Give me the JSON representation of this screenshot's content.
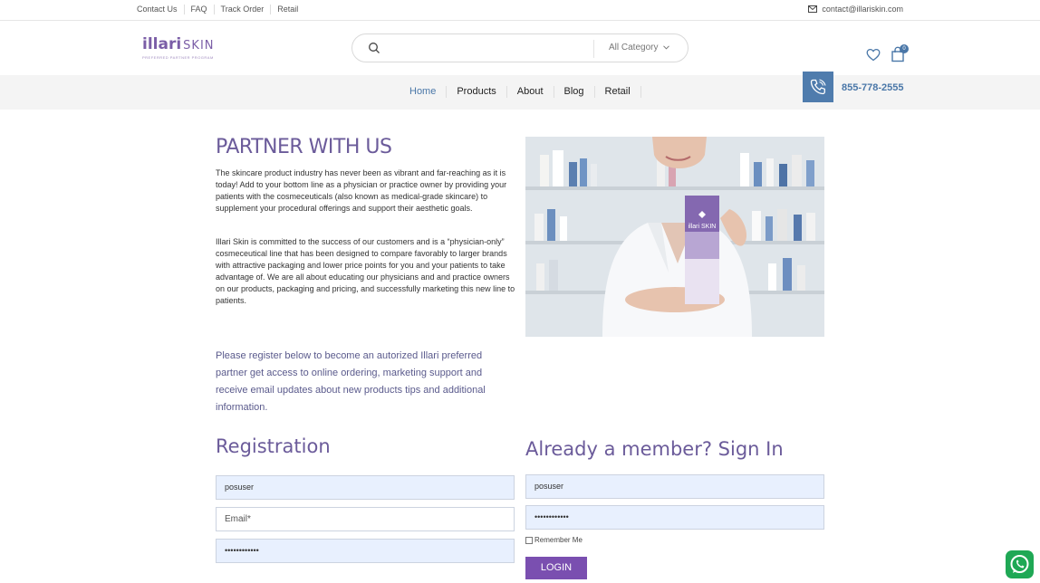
{
  "topbar": {
    "links": [
      "Contact Us",
      "FAQ",
      "Track Order",
      "Retail"
    ],
    "email": "contact@illariskin.com"
  },
  "header": {
    "logo_main": "illari",
    "logo_skin": "SKIN",
    "logo_tagline": "PREFERRED PARTNER PROGRAM",
    "search_placeholder": "",
    "category_label": "All Category",
    "cart_count": "0",
    "icons": [
      "search-icon",
      "chevron-down-icon",
      "heart-icon",
      "cart-icon",
      "mail-icon",
      "phone-icon",
      "whatsapp-icon"
    ]
  },
  "nav": {
    "items": [
      "Home",
      "Products",
      "About",
      "Blog",
      "Retail"
    ],
    "active": "Home",
    "phone": "855-778-2555"
  },
  "main": {
    "title": "PARTNER WITH US",
    "para1": "The skincare product industry has never been as vibrant and far-reaching as it is today! Add to your bottom line as a physician or practice owner by providing your patients with the cosmeceuticals (also known as medical-grade skincare) to supplement your procedural offerings and support their aesthetic goals.",
    "para2": "Illari Skin is committed to the success of our customers and is a “physician-only” cosmeceutical line that has been designed to compare favorably to larger brands with attractive packaging and lower price points for you and your patients to take advantage of. We are all about educating our physicians and and practice owners on our products, packaging and pricing, and successfully marketing this new line to patients.",
    "product_logo": "illari SKIN",
    "invite": "Please register below to become an autorized Illari preferred partner get access to online ordering, marketing support and receive email updates about new products tips and additional information."
  },
  "registration": {
    "title": "Registration",
    "username_value": "posuser",
    "email_placeholder": "Email*",
    "password_value": "••••••••••••"
  },
  "signin": {
    "title": "Already a member? Sign In",
    "username_value": "posuser",
    "password_value": "••••••••••••",
    "remember_label": "Remember Me",
    "login_label": "LOGIN"
  },
  "colors": {
    "accent_purple": "#6b5b9a",
    "button_purple": "#7a4fb0",
    "link_blue": "#4a77a8",
    "whatsapp_green": "#1fa855"
  }
}
